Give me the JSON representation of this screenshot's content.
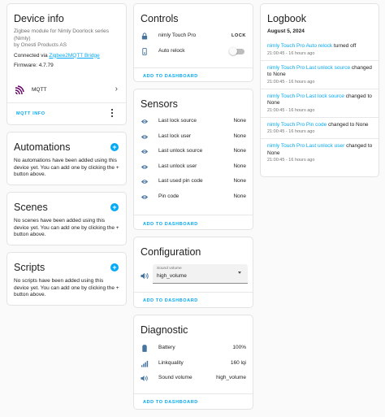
{
  "device_info": {
    "title": "Device info",
    "model": "Zigbee module for Nimly Doorlock series (Nimly)",
    "manufacturer": "by Onesti Products AS",
    "connected_prefix": "Connected via ",
    "connected_link": "Zigbee2MQTT Bridge",
    "firmware": "Firmware: 4.7.79",
    "integration": "MQTT",
    "mqtt_info_button": "MQTT INFO"
  },
  "automations": {
    "title": "Automations",
    "empty_text": "No automations have been added using this device yet. You can add one by clicking the + button above."
  },
  "scenes": {
    "title": "Scenes",
    "empty_text": "No scenes have been added using this device yet. You can add one by clicking the + button above."
  },
  "scripts": {
    "title": "Scripts",
    "empty_text": "No scripts have been added using this device yet. You can add one by clicking the + button above."
  },
  "controls": {
    "title": "Controls",
    "rows": [
      {
        "label": "nimly Touch Pro",
        "value": "LOCK"
      },
      {
        "label": "Auto relock"
      }
    ],
    "add_button": "ADD TO DASHBOARD"
  },
  "sensors": {
    "title": "Sensors",
    "rows": [
      {
        "label": "Last lock source",
        "value": "None"
      },
      {
        "label": "Last lock user",
        "value": "None"
      },
      {
        "label": "Last unlock source",
        "value": "None"
      },
      {
        "label": "Last unlock user",
        "value": "None"
      },
      {
        "label": "Last used pin code",
        "value": "None"
      },
      {
        "label": "Pin code",
        "value": "None"
      }
    ],
    "add_button": "ADD TO DASHBOARD"
  },
  "configuration": {
    "title": "Configuration",
    "select_label": "Sound volume",
    "select_value": "high_volume",
    "add_button": "ADD TO DASHBOARD"
  },
  "diagnostic": {
    "title": "Diagnostic",
    "rows": [
      {
        "label": "Battery",
        "value": "100%"
      },
      {
        "label": "Linkquality",
        "value": "160 lqi"
      },
      {
        "label": "Sound volume",
        "value": "high_volume"
      }
    ],
    "add_button": "ADD TO DASHBOARD"
  },
  "logbook": {
    "title": "Logbook",
    "date": "August 5, 2024",
    "entries": [
      {
        "link": "nimly Touch Pro Auto relock",
        "text": " turned off",
        "time": "21:00:45 - 16 hours ago"
      },
      {
        "link": "nimly Touch Pro Last unlock source",
        "text": " changed to None",
        "time": "21:00:45 - 16 hours ago"
      },
      {
        "link": "nimly Touch Pro Last lock source",
        "text": " changed to None",
        "time": "21:00:45 - 16 hours ago"
      },
      {
        "link": "nimly Touch Pro Pin code",
        "text": " changed to None",
        "time": "21:00:45 - 16 hours ago"
      },
      {
        "link": "nimly Touch Pro Last unlock user",
        "text": " changed to None",
        "time": "21:00:45 - 16 hours ago"
      }
    ]
  },
  "colors": {
    "accent": "#03a9f4",
    "icon": "#44739e",
    "background": "#fafafa",
    "card": "#ffffff"
  }
}
